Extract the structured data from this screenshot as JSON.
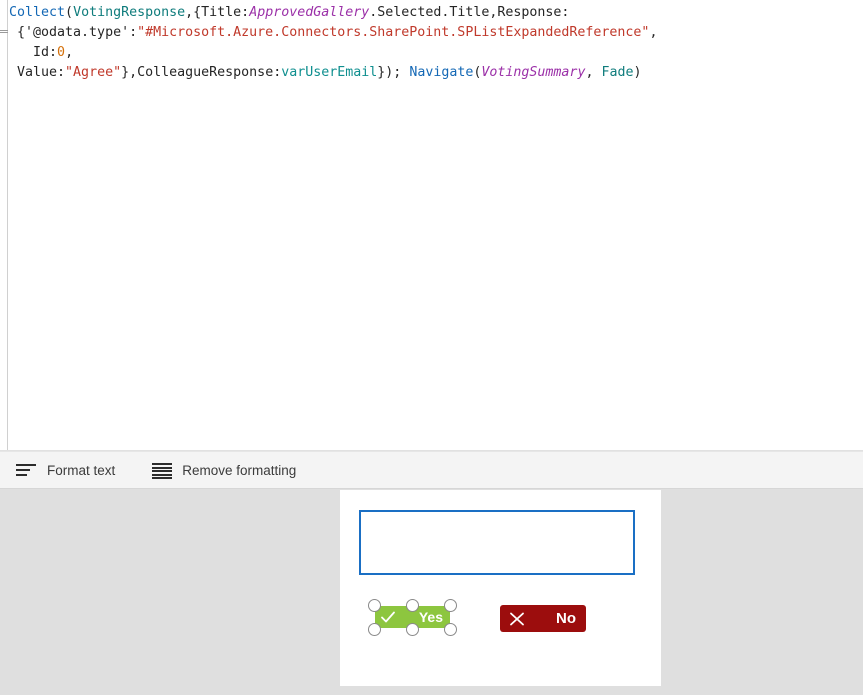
{
  "formula_bar": {
    "name": "power-apps-formula-editor",
    "lines": [
      [
        {
          "text": "Collect",
          "type": "fn"
        },
        {
          "text": "(",
          "type": "punct"
        },
        {
          "text": "VotingResponse",
          "type": "src"
        },
        {
          "text": ",{Title:",
          "type": "plain"
        },
        {
          "text": "ApprovedGallery",
          "type": "ctrl"
        },
        {
          "text": ".Selected.Title,Response:",
          "type": "plain"
        }
      ],
      [
        {
          "text": " {'@odata.type':",
          "type": "plain"
        },
        {
          "text": "\"#Microsoft.Azure.Connectors.SharePoint.SPListExpandedReference\"",
          "type": "str"
        },
        {
          "text": ",",
          "type": "plain"
        }
      ],
      [
        {
          "text": "   Id:",
          "type": "plain"
        },
        {
          "text": "0",
          "type": "num"
        },
        {
          "text": ",",
          "type": "plain"
        }
      ],
      [
        {
          "text": " Value:",
          "type": "plain"
        },
        {
          "text": "\"Agree\"",
          "type": "str"
        },
        {
          "text": "},ColleagueResponse:",
          "type": "plain"
        },
        {
          "text": "varUserEmail",
          "type": "var"
        },
        {
          "text": "}); ",
          "type": "plain"
        },
        {
          "text": "Navigate",
          "type": "fn"
        },
        {
          "text": "(",
          "type": "punct"
        },
        {
          "text": "VotingSummary",
          "type": "ctrl"
        },
        {
          "text": ", ",
          "type": "plain"
        },
        {
          "text": "Fade",
          "type": "enum"
        },
        {
          "text": ")",
          "type": "punct"
        }
      ]
    ],
    "plain_text": "Collect(VotingResponse,{Title:ApprovedGallery.Selected.Title,Response: {'@odata.type':\"#Microsoft.Azure.Connectors.SharePoint.SPListExpandedReference\",   Id:0, Value:\"Agree\"},ColleagueResponse:varUserEmail}); Navigate(VotingSummary, Fade)"
  },
  "toolbar": {
    "format_text_label": "Format text",
    "remove_formatting_label": "Remove formatting"
  },
  "canvas": {
    "textbox": {
      "value": "",
      "placeholder": ""
    },
    "yes_button": {
      "label": "Yes",
      "icon": "check-icon",
      "fill_color": "#8dc63f",
      "text_color": "#ffffff",
      "selected": true
    },
    "no_button": {
      "label": "No",
      "icon": "cross-icon",
      "fill_color": "#9c0d0d",
      "text_color": "#ffffff",
      "selected": false
    }
  },
  "colors": {
    "function": "#1468b5",
    "datasource": "#0f7c7c",
    "control": "#9b30a8",
    "string": "#c0392b",
    "number": "#d4700a",
    "variable": "#0f8f8f",
    "canvas_background": "#dfdfdf",
    "selection_border": "#1a6fc4"
  }
}
